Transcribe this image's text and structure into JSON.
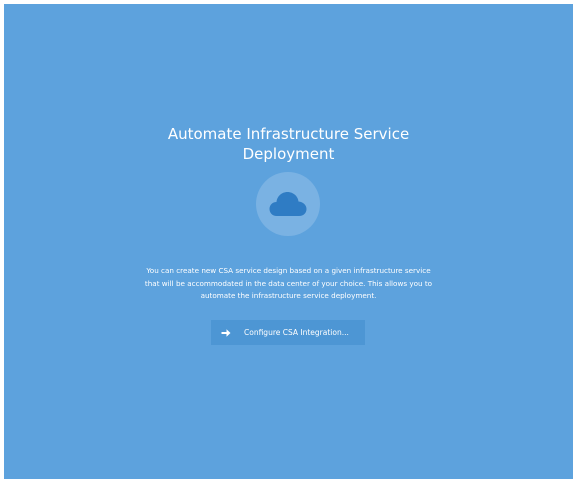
{
  "heading": {
    "line1": "Automate Infrastructure Service",
    "line2": "Deployment"
  },
  "icon": {
    "name": "cloud-icon",
    "circle_color": "#7db5e4",
    "cloud_color": "#2f7cc4"
  },
  "description": {
    "line1": "You can create new CSA service design based on a given infrastructure service",
    "line2": "that will be accommodated in the data center of your choice. This allows you to",
    "line3": "automate the infrastructure service deployment."
  },
  "action": {
    "label": "Configure CSA Integration...",
    "icon": "arrow-right-icon"
  },
  "colors": {
    "background": "#5da2dd",
    "button": "#4d96d4",
    "text": "#ffffff"
  }
}
